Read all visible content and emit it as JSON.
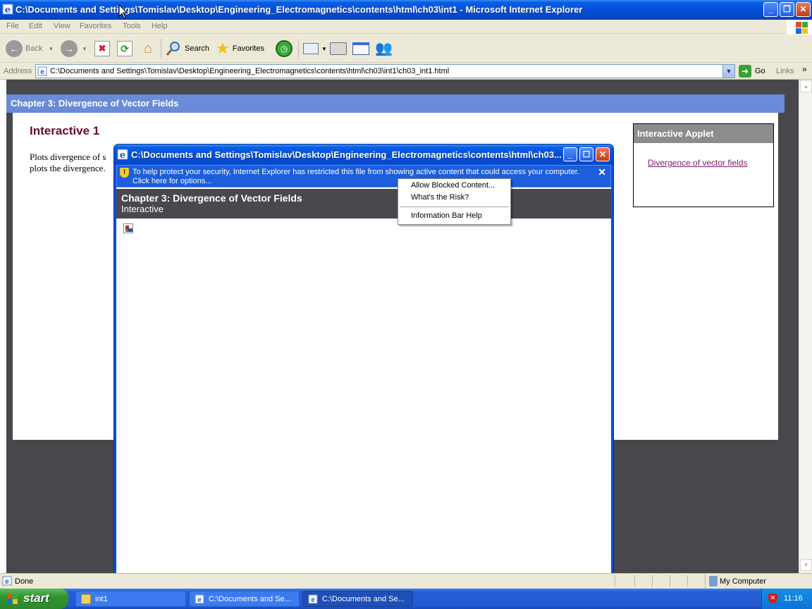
{
  "window": {
    "title": "C:\\Documents and Settings\\Tomislav\\Desktop\\Engineering_Electromagnetics\\contents\\html\\ch03\\int1 - Microsoft Internet Explorer"
  },
  "menu": {
    "items": [
      "File",
      "Edit",
      "View",
      "Favorites",
      "Tools",
      "Help"
    ]
  },
  "toolbar": {
    "back_label": "Back",
    "search_label": "Search",
    "favorites_label": "Favorites"
  },
  "address": {
    "label": "Address",
    "url": "C:\\Documents and Settings\\Tomislav\\Desktop\\Engineering_Electromagnetics\\contents\\html\\ch03\\int1\\ch03_int1.html",
    "go_label": "Go",
    "links_label": "Links"
  },
  "page": {
    "header": "Chapter 3: Divergence of Vector Fields",
    "interactive_title": "Interactive 1",
    "description_line1": "Plots divergence of s",
    "description_line2": "plots the divergence.",
    "applet_box": {
      "heading": "Interactive Applet",
      "link": "Divergence of vector fields"
    }
  },
  "popup": {
    "title": "C:\\Documents and Settings\\Tomislav\\Desktop\\Engineering_Electromagnetics\\contents\\html\\ch03...",
    "infobar_line1": "To help protect your security, Internet Explorer has restricted this file from showing active content that could access your computer.",
    "infobar_line2": "Click here for options...",
    "banner_title": "Chapter 3: Divergence of Vector Fields",
    "banner_subtitle": "Interactive"
  },
  "context_menu": {
    "items": [
      "Allow Blocked Content...",
      "What's the Risk?",
      "Information Bar Help"
    ]
  },
  "statusbar": {
    "text": "Done",
    "zone": "My Computer"
  },
  "taskbar": {
    "start_label": "start",
    "tasks": [
      {
        "label": "int1",
        "icon": "folder-icon"
      },
      {
        "label": "C:\\Documents and Se...",
        "icon": "ie-icon"
      },
      {
        "label": "C:\\Documents and Se...",
        "icon": "ie-icon"
      }
    ],
    "clock": "11:16"
  },
  "colors": {
    "xp_blue": "#0550d8",
    "page_header": "#6a8bd8",
    "title_maroon": "#6a0b2c",
    "banner_gray": "#48494d",
    "start_green": "#2f932f"
  }
}
